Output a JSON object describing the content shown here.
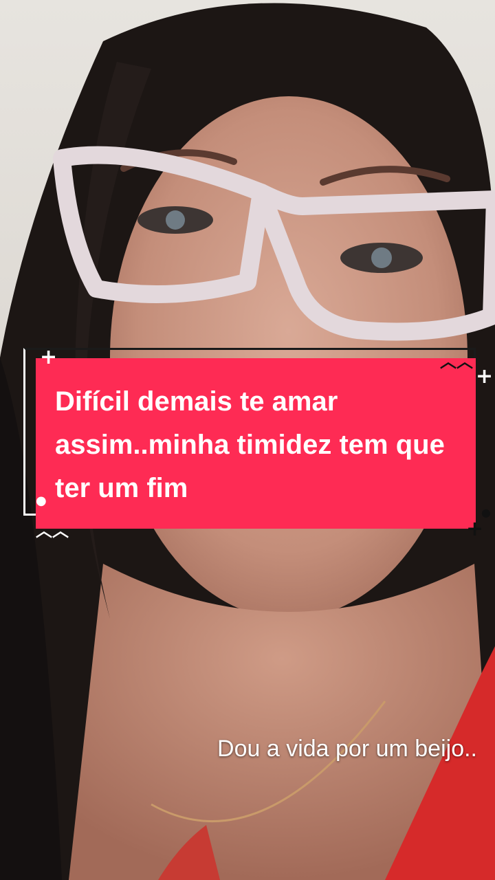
{
  "caption": {
    "text": "Difícil demais te amar assim..minha timidez tem que ter um fim"
  },
  "subtitle": {
    "text": "Dou a vida por um beijo.."
  },
  "colors": {
    "card": "#fe2b54",
    "text": "#ffffff"
  }
}
